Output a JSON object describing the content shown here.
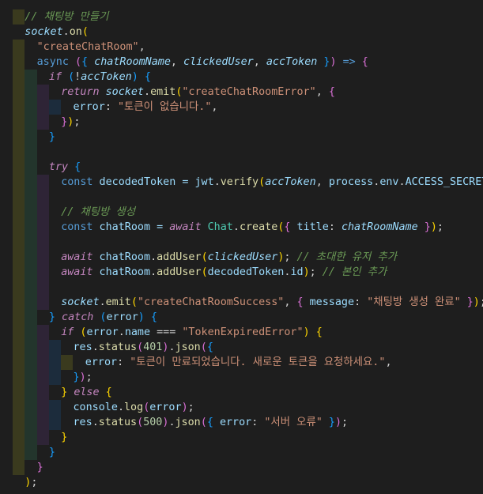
{
  "editor": {
    "background": "#1e1e1e",
    "lines": [
      {
        "indent": 1,
        "guides": [
          0
        ],
        "tokens": [
          [
            "// 채팅방 만들기",
            "c"
          ]
        ]
      },
      {
        "indent": 1,
        "guides": [],
        "tokens": [
          [
            "socket",
            "vi"
          ],
          [
            ".",
            "p"
          ],
          [
            "on",
            "f"
          ],
          [
            "(",
            "b1"
          ]
        ]
      },
      {
        "indent": 2,
        "guides": [
          0
        ],
        "tokens": [
          [
            "\"createChatRoom\"",
            "s"
          ],
          [
            ",",
            "p"
          ]
        ]
      },
      {
        "indent": 2,
        "guides": [
          0
        ],
        "tokens": [
          [
            "async",
            "k"
          ],
          [
            " ",
            "p"
          ],
          [
            "(",
            "b2"
          ],
          [
            "{ ",
            "b3"
          ],
          [
            "chatRoomName",
            "vi"
          ],
          [
            ", ",
            "p"
          ],
          [
            "clickedUser",
            "vi"
          ],
          [
            ", ",
            "p"
          ],
          [
            "accToken",
            "vi"
          ],
          [
            " }",
            "b3"
          ],
          [
            ")",
            "b2"
          ],
          [
            " => ",
            "k"
          ],
          [
            "{",
            "b2"
          ]
        ]
      },
      {
        "indent": 3,
        "guides": [
          0,
          1
        ],
        "tokens": [
          [
            "if",
            "ck"
          ],
          [
            " ",
            "p"
          ],
          [
            "(",
            "b3"
          ],
          [
            "!",
            "p"
          ],
          [
            "accToken",
            "vi"
          ],
          [
            ")",
            "b3"
          ],
          [
            " ",
            "p"
          ],
          [
            "{",
            "b3"
          ]
        ]
      },
      {
        "indent": 4,
        "guides": [
          0,
          1,
          2
        ],
        "tokens": [
          [
            "return",
            "ck"
          ],
          [
            " ",
            "p"
          ],
          [
            "socket",
            "vi"
          ],
          [
            ".",
            "p"
          ],
          [
            "emit",
            "f"
          ],
          [
            "(",
            "b1"
          ],
          [
            "\"createChatRoomError\"",
            "s"
          ],
          [
            ", ",
            "p"
          ],
          [
            "{",
            "b2"
          ]
        ]
      },
      {
        "indent": 5,
        "guides": [
          0,
          1,
          2,
          3
        ],
        "tokens": [
          [
            "error",
            "v"
          ],
          [
            ": ",
            "p"
          ],
          [
            "\"토큰이 없습니다.\"",
            "s"
          ],
          [
            ",",
            "p"
          ]
        ]
      },
      {
        "indent": 4,
        "guides": [
          0,
          1,
          2
        ],
        "tokens": [
          [
            "}",
            "b2"
          ],
          [
            ")",
            "b1"
          ],
          [
            ";",
            "p"
          ]
        ]
      },
      {
        "indent": 3,
        "guides": [
          0,
          1
        ],
        "tokens": [
          [
            "}",
            "b3"
          ]
        ]
      },
      {
        "indent": 0,
        "guides": [
          0,
          1
        ],
        "tokens": []
      },
      {
        "indent": 3,
        "guides": [
          0,
          1
        ],
        "tokens": [
          [
            "try",
            "ck"
          ],
          [
            " ",
            "p"
          ],
          [
            "{",
            "b3"
          ]
        ]
      },
      {
        "indent": 4,
        "guides": [
          0,
          1,
          2
        ],
        "tokens": [
          [
            "const",
            "k"
          ],
          [
            " decodedToken = ",
            "v"
          ],
          [
            "jwt",
            "v"
          ],
          [
            ".",
            "p"
          ],
          [
            "verify",
            "f"
          ],
          [
            "(",
            "b1"
          ],
          [
            "accToken",
            "vi"
          ],
          [
            ", ",
            "p"
          ],
          [
            "process",
            "v"
          ],
          [
            ".",
            "p"
          ],
          [
            "env",
            "v"
          ],
          [
            ".",
            "p"
          ],
          [
            "ACCESS_SECRET",
            "v"
          ],
          [
            ")",
            "b1"
          ],
          [
            ";",
            "p"
          ]
        ]
      },
      {
        "indent": 0,
        "guides": [
          0,
          1,
          2
        ],
        "tokens": []
      },
      {
        "indent": 4,
        "guides": [
          0,
          1,
          2
        ],
        "tokens": [
          [
            "// 채팅방 생성",
            "c"
          ]
        ]
      },
      {
        "indent": 4,
        "guides": [
          0,
          1,
          2
        ],
        "tokens": [
          [
            "const",
            "k"
          ],
          [
            " chatRoom = ",
            "v"
          ],
          [
            "await",
            "ck"
          ],
          [
            " ",
            "p"
          ],
          [
            "Chat",
            "t"
          ],
          [
            ".",
            "p"
          ],
          [
            "create",
            "f"
          ],
          [
            "(",
            "b1"
          ],
          [
            "{ ",
            "b2"
          ],
          [
            "title",
            "v"
          ],
          [
            ": ",
            "p"
          ],
          [
            "chatRoomName",
            "vi"
          ],
          [
            " }",
            "b2"
          ],
          [
            ")",
            "b1"
          ],
          [
            ";",
            "p"
          ]
        ]
      },
      {
        "indent": 0,
        "guides": [
          0,
          1,
          2
        ],
        "tokens": []
      },
      {
        "indent": 4,
        "guides": [
          0,
          1,
          2
        ],
        "tokens": [
          [
            "await",
            "ck"
          ],
          [
            " chatRoom",
            "v"
          ],
          [
            ".",
            "p"
          ],
          [
            "addUser",
            "f"
          ],
          [
            "(",
            "b1"
          ],
          [
            "clickedUser",
            "vi"
          ],
          [
            ")",
            "b1"
          ],
          [
            ";",
            "p"
          ],
          [
            " // 초대한 유저 추가",
            "c"
          ]
        ]
      },
      {
        "indent": 4,
        "guides": [
          0,
          1,
          2
        ],
        "tokens": [
          [
            "await",
            "ck"
          ],
          [
            " chatRoom",
            "v"
          ],
          [
            ".",
            "p"
          ],
          [
            "addUser",
            "f"
          ],
          [
            "(",
            "b1"
          ],
          [
            "decodedToken",
            "v"
          ],
          [
            ".",
            "p"
          ],
          [
            "id",
            "v"
          ],
          [
            ")",
            "b1"
          ],
          [
            ";",
            "p"
          ],
          [
            " // 본인 추가",
            "c"
          ]
        ]
      },
      {
        "indent": 0,
        "guides": [
          0,
          1,
          2
        ],
        "tokens": []
      },
      {
        "indent": 4,
        "guides": [
          0,
          1,
          2
        ],
        "tokens": [
          [
            "socket",
            "vi"
          ],
          [
            ".",
            "p"
          ],
          [
            "emit",
            "f"
          ],
          [
            "(",
            "b1"
          ],
          [
            "\"createChatRoomSuccess\"",
            "s"
          ],
          [
            ", ",
            "p"
          ],
          [
            "{ ",
            "b2"
          ],
          [
            "message",
            "v"
          ],
          [
            ": ",
            "p"
          ],
          [
            "\"채팅방 생성 완료\"",
            "s"
          ],
          [
            " }",
            "b2"
          ],
          [
            ")",
            "b1"
          ],
          [
            ";",
            "p"
          ]
        ]
      },
      {
        "indent": 3,
        "guides": [
          0,
          1
        ],
        "tokens": [
          [
            "}",
            "b3"
          ],
          [
            " ",
            "p"
          ],
          [
            "catch",
            "ck"
          ],
          [
            " ",
            "p"
          ],
          [
            "(",
            "b3"
          ],
          [
            "error",
            "v"
          ],
          [
            ")",
            "b3"
          ],
          [
            " ",
            "p"
          ],
          [
            "{",
            "b3"
          ]
        ]
      },
      {
        "indent": 4,
        "guides": [
          0,
          1,
          2
        ],
        "tokens": [
          [
            "if",
            "ck"
          ],
          [
            " ",
            "p"
          ],
          [
            "(",
            "b1"
          ],
          [
            "error",
            "v"
          ],
          [
            ".",
            "p"
          ],
          [
            "name",
            "v"
          ],
          [
            " === ",
            "p"
          ],
          [
            "\"TokenExpiredError\"",
            "s"
          ],
          [
            ")",
            "b1"
          ],
          [
            " ",
            "p"
          ],
          [
            "{",
            "b1"
          ]
        ]
      },
      {
        "indent": 5,
        "guides": [
          0,
          1,
          2,
          3
        ],
        "tokens": [
          [
            "res",
            "v"
          ],
          [
            ".",
            "p"
          ],
          [
            "status",
            "f"
          ],
          [
            "(",
            "b2"
          ],
          [
            "401",
            "n"
          ],
          [
            ")",
            "b2"
          ],
          [
            ".",
            "p"
          ],
          [
            "json",
            "f"
          ],
          [
            "(",
            "b2"
          ],
          [
            "{",
            "b3"
          ]
        ]
      },
      {
        "indent": 6,
        "guides": [
          0,
          1,
          2,
          3,
          4
        ],
        "tokens": [
          [
            "error",
            "v"
          ],
          [
            ": ",
            "p"
          ],
          [
            "\"토큰이 만료되었습니다. 새로운 토큰을 요청하세요.\"",
            "s"
          ],
          [
            ",",
            "p"
          ]
        ]
      },
      {
        "indent": 5,
        "guides": [
          0,
          1,
          2,
          3
        ],
        "tokens": [
          [
            "}",
            "b3"
          ],
          [
            ")",
            "b2"
          ],
          [
            ";",
            "p"
          ]
        ]
      },
      {
        "indent": 4,
        "guides": [
          0,
          1,
          2
        ],
        "tokens": [
          [
            "}",
            "b1"
          ],
          [
            " ",
            "p"
          ],
          [
            "else",
            "ck"
          ],
          [
            " ",
            "p"
          ],
          [
            "{",
            "b1"
          ]
        ]
      },
      {
        "indent": 5,
        "guides": [
          0,
          1,
          2,
          3
        ],
        "tokens": [
          [
            "console",
            "v"
          ],
          [
            ".",
            "p"
          ],
          [
            "log",
            "f"
          ],
          [
            "(",
            "b2"
          ],
          [
            "error",
            "v"
          ],
          [
            ")",
            "b2"
          ],
          [
            ";",
            "p"
          ]
        ]
      },
      {
        "indent": 5,
        "guides": [
          0,
          1,
          2,
          3
        ],
        "tokens": [
          [
            "res",
            "v"
          ],
          [
            ".",
            "p"
          ],
          [
            "status",
            "f"
          ],
          [
            "(",
            "b2"
          ],
          [
            "500",
            "n"
          ],
          [
            ")",
            "b2"
          ],
          [
            ".",
            "p"
          ],
          [
            "json",
            "f"
          ],
          [
            "(",
            "b2"
          ],
          [
            "{ ",
            "b3"
          ],
          [
            "error",
            "v"
          ],
          [
            ": ",
            "p"
          ],
          [
            "\"서버 오류\"",
            "s"
          ],
          [
            " }",
            "b3"
          ],
          [
            ")",
            "b2"
          ],
          [
            ";",
            "p"
          ]
        ]
      },
      {
        "indent": 4,
        "guides": [
          0,
          1,
          2
        ],
        "tokens": [
          [
            "}",
            "b1"
          ]
        ]
      },
      {
        "indent": 3,
        "guides": [
          0,
          1
        ],
        "tokens": [
          [
            "}",
            "b3"
          ]
        ]
      },
      {
        "indent": 2,
        "guides": [
          0
        ],
        "tokens": [
          [
            "}",
            "b2"
          ]
        ]
      },
      {
        "indent": 1,
        "guides": [],
        "tokens": [
          [
            ")",
            "b1"
          ],
          [
            ";",
            "p"
          ]
        ]
      }
    ]
  }
}
